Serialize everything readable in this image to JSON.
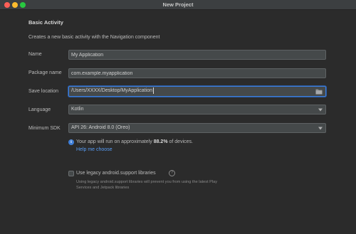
{
  "window": {
    "title": "New Project"
  },
  "page": {
    "heading": "Basic Activity",
    "description": "Creates a new basic activity with the Navigation component"
  },
  "form": {
    "name": {
      "label": "Name",
      "value": "My Application"
    },
    "package": {
      "label": "Package name",
      "value": "com.example.myapplication"
    },
    "save_location": {
      "label": "Save location",
      "value": "/Users/XXXX/Desktop/MyApplication",
      "icon": "folder-icon"
    },
    "language": {
      "label": "Language",
      "selected": "Kotlin"
    },
    "min_sdk": {
      "label": "Minimum SDK",
      "selected": "API 26: Android 8.0 (Oreo)"
    }
  },
  "info": {
    "prefix": "Your app will run on approximately ",
    "percent": "88.2%",
    "suffix": " of devices.",
    "help_link": "Help me choose"
  },
  "legacy": {
    "checkbox_label": "Use legacy android.support libraries",
    "checked": false,
    "hint": "Using legacy android.support libraries will prevent you from using the latest Play Services and Jetpack libraries"
  },
  "colors": {
    "accent": "#3d7ddb",
    "link": "#589df6",
    "background": "#2b2b2b",
    "field": "#45494a"
  }
}
